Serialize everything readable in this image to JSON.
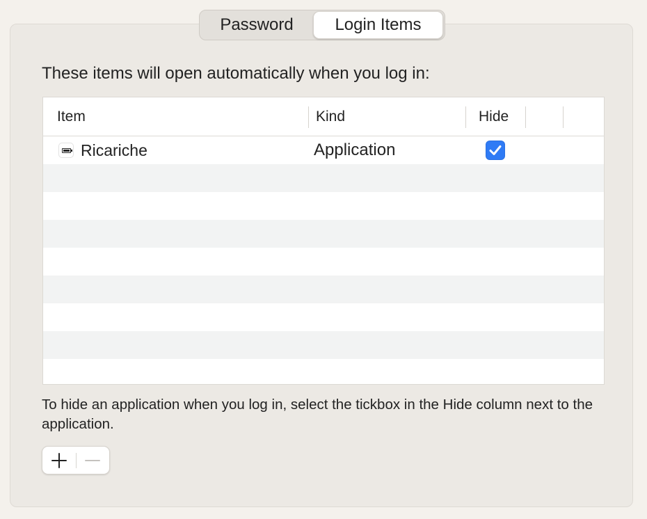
{
  "tabs": [
    {
      "label": "Password",
      "selected": false
    },
    {
      "label": "Login Items",
      "selected": true
    }
  ],
  "intro_text": "These items will open automatically when you log in:",
  "table": {
    "columns": [
      "Item",
      "Kind",
      "Hide"
    ],
    "rows": [
      {
        "icon": "battery-icon",
        "item": "Ricariche",
        "kind": "Application",
        "hide": true
      }
    ]
  },
  "footnote": "To hide an application when you log in, select the tickbox in the Hide column next to the application.",
  "controls": {
    "add_icon": "plus-icon",
    "remove_icon": "minus-icon",
    "remove_enabled": false
  },
  "colors": {
    "accent": "#2f7bf5",
    "panel": "#ece9e4",
    "window": "#f4f1ec"
  }
}
